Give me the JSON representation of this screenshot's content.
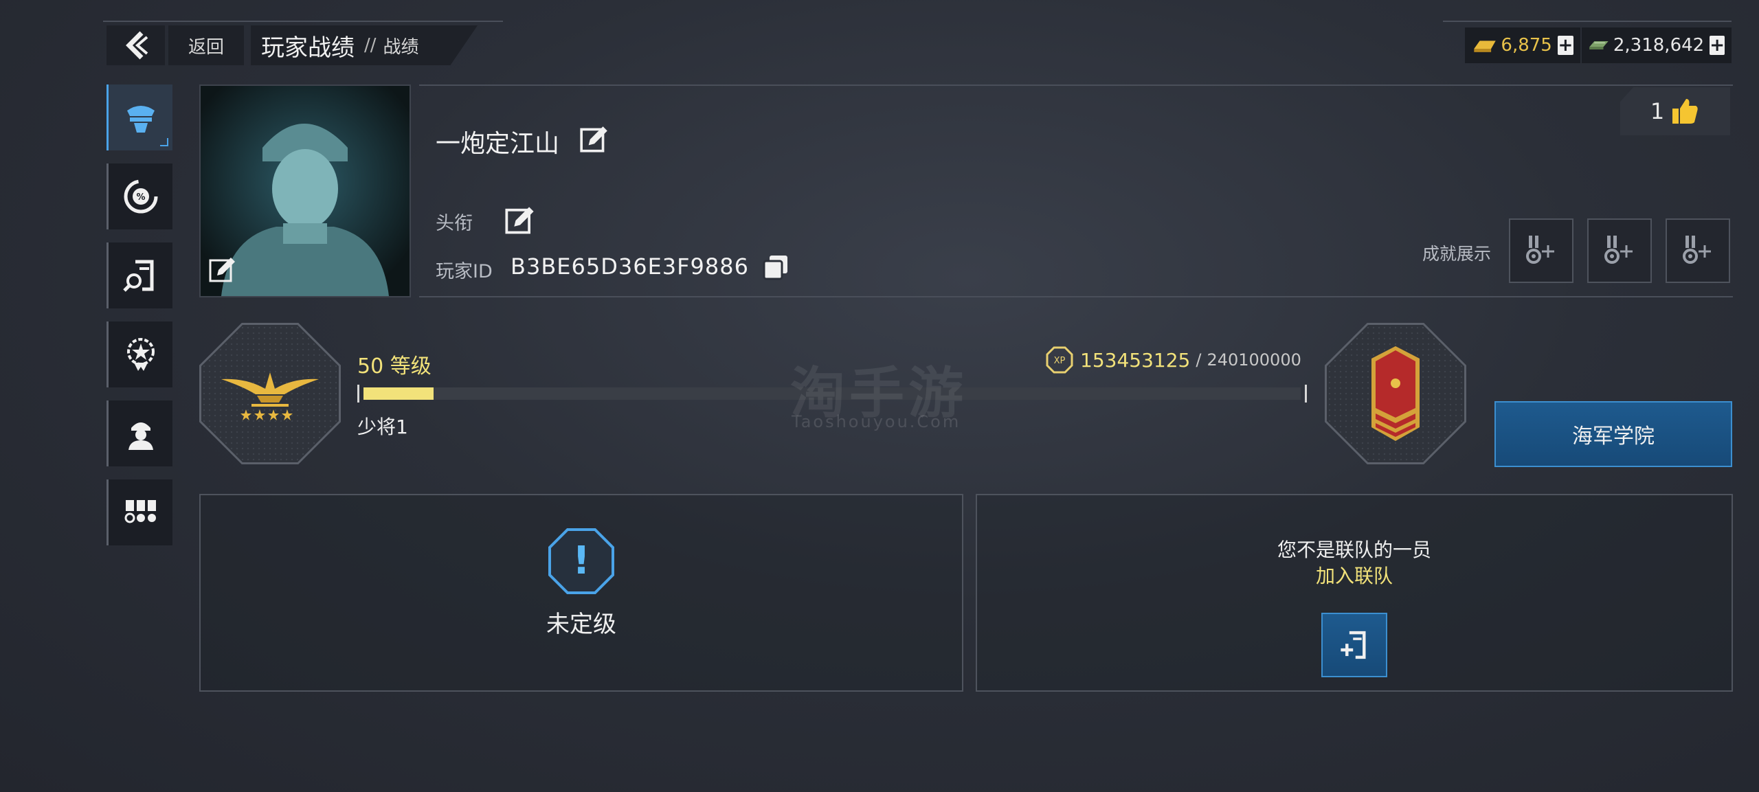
{
  "header": {
    "back_label": "返回",
    "title": "玩家战绩",
    "separator": "//",
    "subtitle": "战绩"
  },
  "currency": {
    "gold": "6,875",
    "cash": "2,318,642"
  },
  "sidebar": {
    "items": [
      {
        "icon": "officer-cap-icon",
        "active": true
      },
      {
        "icon": "percent-gauge-icon",
        "active": false
      },
      {
        "icon": "search-record-icon",
        "active": false
      },
      {
        "icon": "star-badge-icon",
        "active": false
      },
      {
        "icon": "soldier-icon",
        "active": false
      },
      {
        "icon": "medals-icon",
        "active": false
      }
    ]
  },
  "profile": {
    "name": "一炮定江山",
    "title_label": "头衔",
    "id_label": "玩家ID",
    "player_id": "B3BE65D36E3F9886",
    "likes": "1",
    "achievements_label": "成就展示"
  },
  "level": {
    "level_text": "50 等级",
    "rank_name": "少将1",
    "xp_current": "153453125",
    "xp_sep": "/",
    "xp_total": "240100000",
    "xp_badge": "XP",
    "progress": 0.0745
  },
  "academy_button": "海军学院",
  "ranked": {
    "status": "未定级",
    "icon_mark": "!"
  },
  "clan": {
    "message": "您不是联队的一员",
    "join_link": "加入联队"
  },
  "watermark": {
    "title": "淘手游",
    "url": "Taoshouyou.Com"
  },
  "colors": {
    "accent_blue": "#4aa3e8",
    "gold_text": "#f2e27a",
    "xp_fill": "#f2e27a",
    "rank_red": "#b52a2a"
  }
}
